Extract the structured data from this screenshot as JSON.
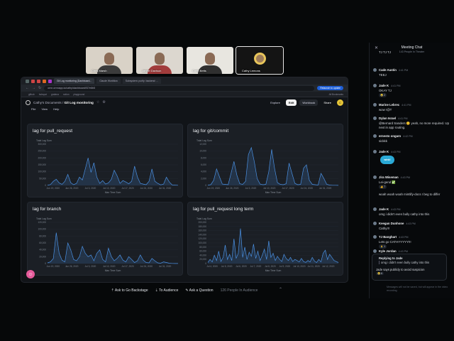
{
  "participants": [
    {
      "name": "Chris Marsh",
      "bg": "#d9d2c7",
      "shirt": "#3b3b3b"
    },
    {
      "name": "Jahnel Davison",
      "bg": "#dcd7cf",
      "shirt": "#a23c3c"
    },
    {
      "name": "Corin Betts",
      "bg": "#e8e6e0",
      "shirt": "#2f2f2f"
    },
    {
      "name": "Cathy Lemons",
      "bg": "#141414",
      "shirt": "#9b7a5a"
    }
  ],
  "browser": {
    "tabs": [
      "Git Log monitoring (Dashboard...",
      "Claude Workflow",
      "Subsystem: purify: backend: ..."
    ],
    "url": "ornn.ornnapp.io/cathy/dashboard/f37e6b5",
    "relaunch": "Relaunch to update",
    "bookmarks": [
      "github",
      "hubspot",
      "grafana",
      "notion",
      "playground",
      "All Bookmarks"
    ]
  },
  "app": {
    "crumb_root": "Cathy's Documents",
    "crumb_sep": "/",
    "crumb_page": "Git Log monitoring",
    "explore": "Explore",
    "edit": "Edit",
    "workbook": "Workbook",
    "share": "Share",
    "user_initial": "C",
    "menu": [
      "File",
      "View",
      "Help"
    ]
  },
  "emoji_button": "☺",
  "chart_data": [
    {
      "type": "area",
      "title": "lag for pull_request",
      "ylabel": "Total Lag Sum",
      "xlabel": "Max Time Sum",
      "y_ticks": [
        "300,000",
        "250,000",
        "200,000",
        "150,000",
        "100,000",
        "50,000",
        "0"
      ],
      "x_ticks": [
        "Jun 19, 2020",
        "Jun 26, 2020",
        "Jul 3, 2020",
        "Jul 10, 2020",
        "Jul 17, 2020",
        "Jul 24, 2020",
        "Jul 31, 2020"
      ],
      "ylim": [
        0,
        300000
      ],
      "values": [
        2000,
        6000,
        30000,
        45000,
        18000,
        8000,
        30000,
        80000,
        20000,
        5000,
        15000,
        60000,
        40000,
        120000,
        200000,
        95000,
        165000,
        60000,
        15000,
        35000,
        10000,
        18000,
        45000,
        110000,
        70000,
        15000,
        35000,
        25000,
        12000,
        30000,
        140000,
        60000,
        15000,
        10000,
        5000,
        30000,
        120000,
        30000,
        15000,
        4000,
        10000,
        60000,
        25000,
        3000,
        2000,
        1000
      ]
    },
    {
      "type": "area",
      "title": "lag for git/commit",
      "ylabel": "Total Lag Sum",
      "xlabel": "Max Time Sum",
      "y_ticks": [
        "12,000",
        "10,000",
        "8,000",
        "6,000",
        "4,000",
        "2,000",
        "0"
      ],
      "x_ticks": [
        "Jun 19, 2020",
        "Jun 26, 2020",
        "Jul 3, 2020",
        "Jul 10, 2020",
        "Jul 17, 2020",
        "Jul 24, 2020",
        "Jul 31, 2020"
      ],
      "ylim": [
        0,
        12000
      ],
      "values": [
        100,
        200,
        1500,
        4800,
        2500,
        400,
        300,
        200,
        3500,
        7000,
        3000,
        500,
        300,
        1200,
        9000,
        11000,
        7000,
        2000,
        400,
        200,
        300,
        4000,
        10500,
        5000,
        800,
        300,
        200,
        500,
        6500,
        3500,
        600,
        200,
        300,
        5000,
        6000,
        1500,
        300,
        200,
        100,
        3500,
        2000,
        300,
        100,
        50,
        50,
        30
      ]
    },
    {
      "type": "area",
      "title": "lag for branch",
      "ylabel": "Total Lag Sum",
      "xlabel": "Max Time Sum",
      "y_ticks": [
        "120,000",
        "100,000",
        "80,000",
        "60,000",
        "40,000",
        "20,000",
        "0"
      ],
      "x_ticks": [
        "Jun 19, 2020",
        "Jun 26, 2020",
        "Jul 3, 2020",
        "Jul 10, 2020",
        "Jul 17, 2020",
        "Jul 24, 2020",
        "Jul 31, 2020"
      ],
      "ylim": [
        0,
        120000
      ],
      "values": [
        2000,
        5000,
        15000,
        90000,
        30000,
        10000,
        5000,
        60000,
        40000,
        12000,
        8000,
        20000,
        50000,
        30000,
        20000,
        25000,
        8000,
        30000,
        40000,
        12000,
        5000,
        45000,
        20000,
        8000,
        15000,
        25000,
        10000,
        5000,
        20000,
        12000,
        3000,
        8000,
        25000,
        10000,
        3000,
        2000,
        15000,
        8000,
        2000,
        1000,
        5000,
        3000,
        1000,
        500,
        300,
        200
      ]
    },
    {
      "type": "area",
      "title": "lag for pull_request long term",
      "ylabel": "Total Lag Sum",
      "xlabel": "Max Time Sum",
      "y_ticks": [
        "200,000",
        "180,000",
        "160,000",
        "140,000",
        "120,000",
        "100,000",
        "80,000",
        "60,000",
        "40,000",
        "20,000",
        "0"
      ],
      "x_ticks": [
        "Jul 4, 2020",
        "Jul 5, 2020",
        "Jul 6, 2020",
        "Jul 7, 2020",
        "Jul 8, 2020",
        "Jul 9, 2020",
        "Jul 10, 2020",
        "Jul 11, 2020",
        "Jul 12, 2020"
      ],
      "ylim": [
        0,
        200000
      ],
      "values": [
        5000,
        20000,
        8000,
        40000,
        15000,
        60000,
        10000,
        30000,
        90000,
        20000,
        45000,
        15000,
        120000,
        25000,
        50000,
        170000,
        30000,
        80000,
        20000,
        55000,
        35000,
        95000,
        25000,
        60000,
        15000,
        40000,
        70000,
        20000,
        110000,
        30000,
        50000,
        15000,
        35000,
        20000,
        10000,
        45000,
        25000,
        15000,
        30000,
        10000,
        20000,
        15000,
        8000,
        25000,
        10000,
        6000,
        15000,
        8000,
        30000,
        12000,
        5000,
        20000,
        8000,
        50000,
        65000,
        20000,
        45000,
        30000,
        15000,
        10000,
        5000
      ]
    }
  ],
  "stage": {
    "backstage": "Ask to Go Backstage",
    "audience": "To Audience",
    "question": "Ask a Question",
    "people": "126 People In Audience"
  },
  "chat": {
    "title": "Meeting Chat",
    "subtitle": "143 People In Theater",
    "close": "✕",
    "messages": [
      {
        "who": "",
        "ts": "",
        "text": "TJ TJ TJ",
        "top": 6
      },
      {
        "who": "Cade Austin",
        "ts": "4:41 PM",
        "text": "TEEJ",
        "top": 31
      },
      {
        "who": "Jade K",
        "ts": "4:41 PM",
        "text": "OKAY TJ",
        "reaction": "😂 2",
        "top": 53
      },
      {
        "who": "Marine Lebrec",
        "ts": "4:41 PM",
        "text": "wow !@T",
        "top": 80
      },
      {
        "who": "Dylan Israel",
        "ts": "4:41 PM",
        "text": "@Bernard Sanders 😊 yeah, no more required. Up next in app routing.",
        "top": 99
      },
      {
        "who": "ernesto ongaro",
        "ts": "4:42 PM",
        "text": "sickkk",
        "top": 124
      },
      {
        "who": "Jade K",
        "ts": "4:43 PM",
        "text": "",
        "sticker": "wink!",
        "top": 146
      },
      {
        "who": "Jira Wiseman",
        "ts": "4:43 PM",
        "text": "Lei-gend ✅",
        "reaction": "👍 7",
        "top": 182
      },
      {
        "who": "",
        "ts": "",
        "text": "woah woah woah mintlify-docs I beg to differ",
        "top": 206
      },
      {
        "who": "Jade K",
        "ts": "4:43 PM",
        "text": "omg i didn't even bully cathy into this",
        "top": 227
      },
      {
        "who": "Keegan Dunhone",
        "ts": "4:43 PM",
        "text": "Cathy!!!",
        "top": 247
      },
      {
        "who": "TJ Banghart",
        "ts": "4:43 PM",
        "text": "Lets go CATHYYYYY!!!",
        "reaction": "🙏 1",
        "top": 266
      },
      {
        "who": "Kyle Jordan",
        "ts": "4:43 PM",
        "text": "",
        "top": 286
      }
    ],
    "reply": {
      "header": "Replying to Jade",
      "quote": "omg i didn't even bully cathy into this",
      "text": "Jade says publicly to avoid suspicion",
      "reaction": "😂 6"
    },
    "note": "Messages will not be saved, but will appear in the video recording"
  }
}
